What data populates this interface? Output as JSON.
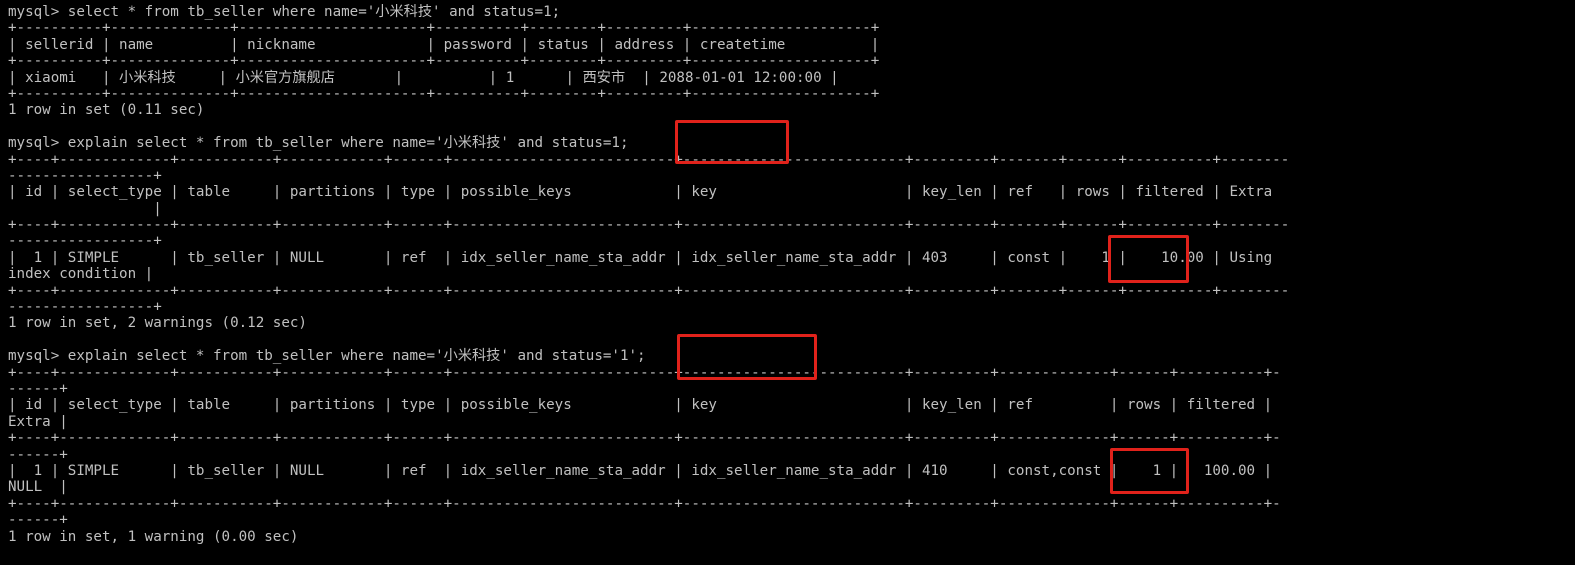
{
  "terminal": {
    "lines": [
      "mysql> select * from tb_seller where name='小米科技' and status=1;",
      "+----------+--------------+----------------------+----------+--------+---------+---------------------+",
      "| sellerid | name         | nickname             | password | status | address | createtime          |",
      "+----------+--------------+----------------------+----------+--------+---------+---------------------+",
      "| xiaomi   | 小米科技     | 小米官方旗舰店       |          | 1      | 西安市  | 2088-01-01 12:00:00 |",
      "+----------+--------------+----------------------+----------+--------+---------+---------------------+",
      "1 row in set (0.11 sec)",
      "",
      "mysql> explain select * from tb_seller where name='小米科技' and status=1;",
      "+----+-------------+-----------+------------+------+--------------------------+--------------------------+---------+-------+------+----------+--------",
      "-----------------+",
      "| id | select_type | table     | partitions | type | possible_keys            | key                      | key_len | ref   | rows | filtered | Extra",
      "                 |",
      "+----+-------------+-----------+------------+------+--------------------------+--------------------------+---------+-------+------+----------+--------",
      "-----------------+",
      "|  1 | SIMPLE      | tb_seller | NULL       | ref  | idx_seller_name_sta_addr | idx_seller_name_sta_addr | 403     | const |    1 |    10.00 | Using",
      "index condition |",
      "+----+-------------+-----------+------------+------+--------------------------+--------------------------+---------+-------+------+----------+--------",
      "-----------------+",
      "1 row in set, 2 warnings (0.12 sec)",
      "",
      "mysql> explain select * from tb_seller where name='小米科技' and status='1';",
      "+----+-------------+-----------+------------+------+--------------------------+--------------------------+---------+-------------+------+----------+-",
      "------+",
      "| id | select_type | table     | partitions | type | possible_keys            | key                      | key_len | ref         | rows | filtered |",
      "Extra |",
      "+----+-------------+-----------+------------+------+--------------------------+--------------------------+---------+-------------+------+----------+-",
      "------+",
      "|  1 | SIMPLE      | tb_seller | NULL       | ref  | idx_seller_name_sta_addr | idx_seller_name_sta_addr | 410     | const,const |    1 |   100.00 |",
      "NULL  |",
      "+----+-------------+-----------+------------+------+--------------------------+--------------------------+---------+-------------+------+----------+-",
      "------+",
      "1 row in set, 1 warning (0.00 sec)"
    ]
  },
  "colors": {
    "background": "#000000",
    "text": "#c0c0c0",
    "highlight": "#e0221b"
  }
}
